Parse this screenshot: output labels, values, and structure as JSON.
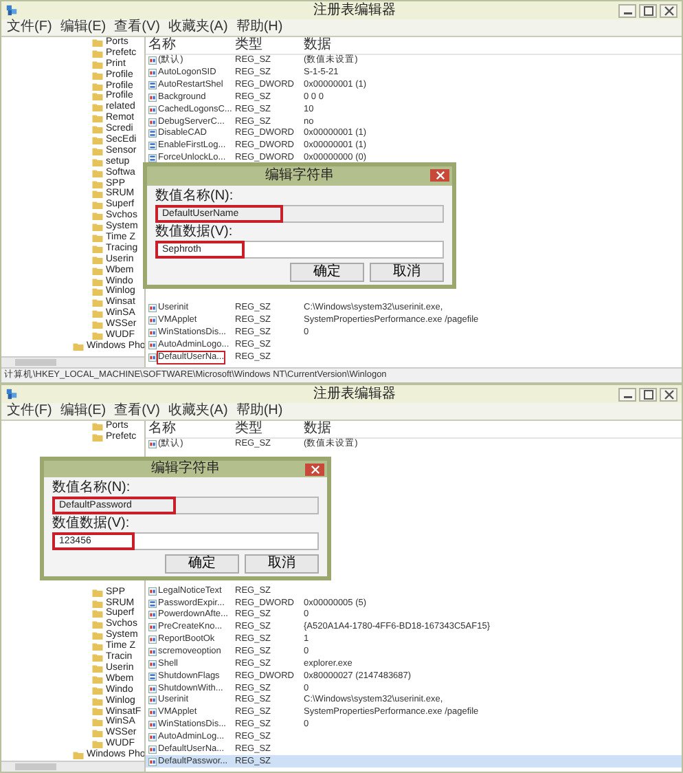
{
  "windows": [
    {
      "title": "注册表编辑器",
      "menu": [
        "文件(F)",
        "编辑(E)",
        "查看(V)",
        "收藏夹(A)",
        "帮助(H)"
      ],
      "tree": {
        "top": [
          {
            "label": "Ports"
          },
          {
            "label": "Prefetc"
          },
          {
            "label": "Print"
          },
          {
            "label": "Profile"
          },
          {
            "label": "Profile"
          },
          {
            "label": "Profile"
          },
          {
            "label": "related"
          },
          {
            "label": "Remot"
          },
          {
            "label": "Scredi"
          },
          {
            "label": "SecEdi"
          },
          {
            "label": "Sensor"
          },
          {
            "label": "setup"
          },
          {
            "label": "Softwa"
          },
          {
            "label": "SPP"
          },
          {
            "label": "SRUM"
          },
          {
            "label": "Superf"
          },
          {
            "label": "Svchos"
          },
          {
            "label": "System"
          },
          {
            "label": "Time Z"
          },
          {
            "label": "Tracing"
          },
          {
            "label": "Userin"
          },
          {
            "label": "Wbem"
          },
          {
            "label": "Windo"
          },
          {
            "label": "Winlog"
          },
          {
            "label": "Winsat"
          },
          {
            "label": "WinSA"
          },
          {
            "label": "WSSer"
          },
          {
            "label": "WUDF"
          },
          {
            "label": "Windows Pho",
            "kind": "outer"
          }
        ]
      },
      "columns": [
        "名称",
        "类型",
        "数据"
      ],
      "rows": {
        "top": [
          {
            "name": "(默认)",
            "type": "REG_SZ",
            "data": "(数值未设置)",
            "kind": "string",
            "highlighted": false,
            "selected": false
          },
          {
            "name": "AutoLogonSID",
            "type": "REG_SZ",
            "data": "S-1-5-21",
            "kind": "string",
            "highlighted": false,
            "selected": false
          },
          {
            "name": "AutoRestartShel",
            "type": "REG_DWORD",
            "data": "0x00000001 (1)",
            "kind": "dword",
            "highlighted": false,
            "selected": false
          },
          {
            "name": "Background",
            "type": "REG_SZ",
            "data": "0 0 0",
            "kind": "string",
            "highlighted": false,
            "selected": false
          },
          {
            "name": "CachedLogonsC...",
            "type": "REG_SZ",
            "data": "10",
            "kind": "string",
            "highlighted": false,
            "selected": false
          },
          {
            "name": "DebugServerC...",
            "type": "REG_SZ",
            "data": "no",
            "kind": "string",
            "highlighted": false,
            "selected": false
          },
          {
            "name": "DisableCAD",
            "type": "REG_DWORD",
            "data": "0x00000001 (1)",
            "kind": "dword",
            "highlighted": false,
            "selected": false
          },
          {
            "name": "EnableFirstLog...",
            "type": "REG_DWORD",
            "data": "0x00000001 (1)",
            "kind": "dword",
            "highlighted": false,
            "selected": false
          },
          {
            "name": "ForceUnlockLo...",
            "type": "REG_DWORD",
            "data": "0x00000000 (0)",
            "kind": "dword",
            "highlighted": false,
            "selected": false
          }
        ],
        "bottom": [
          {
            "name": "Userinit",
            "type": "REG_SZ",
            "data": "C:\\Windows\\system32\\userinit.exe,",
            "kind": "string",
            "highlighted": false,
            "selected": false
          },
          {
            "name": "VMApplet",
            "type": "REG_SZ",
            "data": "SystemPropertiesPerformance.exe /pagefile",
            "kind": "string",
            "highlighted": false,
            "selected": false
          },
          {
            "name": "WinStationsDis...",
            "type": "REG_SZ",
            "data": "0",
            "kind": "string",
            "highlighted": false,
            "selected": false
          },
          {
            "name": "AutoAdminLogo...",
            "type": "REG_SZ",
            "kind": "string",
            "highlighted": false,
            "selected": false
          },
          {
            "name": "DefaultUserNa...",
            "type": "REG_SZ",
            "kind": "string",
            "highlighted": true,
            "selected": false
          }
        ]
      },
      "dialog": {
        "title": "编辑字符串",
        "name_label": "数值名称(N):",
        "name_value": "DefaultUserName",
        "name_highlighted": true,
        "data_label": "数值数据(V):",
        "data_value": "Sephroth",
        "data_highlighted": true,
        "buttons": [
          "确定",
          "取消"
        ]
      },
      "status_bar": "计算机\\HKEY_LOCAL_MACHINE\\SOFTWARE\\Microsoft\\Windows NT\\CurrentVersion\\Winlogon"
    },
    {
      "title": "注册表编辑器",
      "menu": [
        "文件(F)",
        "编辑(E)",
        "查看(V)",
        "收藏夹(A)",
        "帮助(H)"
      ],
      "tree": {
        "top": [
          {
            "label": "Ports"
          },
          {
            "label": "Prefetc"
          }
        ],
        "bottom": [
          {
            "label": "SPP"
          },
          {
            "label": "SRUM"
          },
          {
            "label": "Superf"
          },
          {
            "label": "Svchos"
          },
          {
            "label": "System"
          },
          {
            "label": "Time Z"
          },
          {
            "label": "Tracin"
          },
          {
            "label": "Userin"
          },
          {
            "label": "Wbem"
          },
          {
            "label": "Windo"
          },
          {
            "label": "Winlog"
          },
          {
            "label": "WinsatF"
          },
          {
            "label": "WinSA"
          },
          {
            "label": "WSSer"
          },
          {
            "label": "WUDF"
          },
          {
            "label": "Windows Pho",
            "kind": "outer"
          }
        ]
      },
      "columns": [
        "名称",
        "类型",
        "数据"
      ],
      "rows": {
        "top": [
          {
            "name": "(默认)",
            "type": "REG_SZ",
            "data": "(数值未设置)",
            "kind": "string",
            "highlighted": false,
            "selected": false
          }
        ],
        "bottom": [
          {
            "name": "LegalNoticeText",
            "type": "REG_SZ",
            "kind": "string",
            "highlighted": false,
            "selected": false
          },
          {
            "name": "PasswordExpir...",
            "type": "REG_DWORD",
            "data": "0x00000005 (5)",
            "kind": "dword",
            "highlighted": false,
            "selected": false
          },
          {
            "name": "PowerdownAfte...",
            "type": "REG_SZ",
            "data": "0",
            "kind": "string",
            "highlighted": false,
            "selected": false
          },
          {
            "name": "PreCreateKno...",
            "type": "REG_SZ",
            "data": "{A520A1A4-1780-4FF6-BD18-167343C5AF15}",
            "kind": "string",
            "highlighted": false,
            "selected": false
          },
          {
            "name": "ReportBootOk",
            "type": "REG_SZ",
            "data": "1",
            "kind": "string",
            "highlighted": false,
            "selected": false
          },
          {
            "name": "scremoveoption",
            "type": "REG_SZ",
            "data": "0",
            "kind": "string",
            "highlighted": false,
            "selected": false
          },
          {
            "name": "Shell",
            "type": "REG_SZ",
            "data": "explorer.exe",
            "kind": "string",
            "highlighted": false,
            "selected": false
          },
          {
            "name": "ShutdownFlags",
            "type": "REG_DWORD",
            "data": "0x80000027 (2147483687)",
            "kind": "dword",
            "highlighted": false,
            "selected": false
          },
          {
            "name": "ShutdownWith...",
            "type": "REG_SZ",
            "data": "0",
            "kind": "string",
            "highlighted": false,
            "selected": false
          },
          {
            "name": "Userinit",
            "type": "REG_SZ",
            "data": "C:\\Windows\\system32\\userinit.exe,",
            "kind": "string",
            "highlighted": false,
            "selected": false
          },
          {
            "name": "VMApplet",
            "type": "REG_SZ",
            "data": "SystemPropertiesPerformance.exe /pagefile",
            "kind": "string",
            "highlighted": false,
            "selected": false
          },
          {
            "name": "WinStationsDis...",
            "type": "REG_SZ",
            "data": "0",
            "kind": "string",
            "highlighted": false,
            "selected": false
          },
          {
            "name": "AutoAdminLog...",
            "type": "REG_SZ",
            "kind": "string",
            "highlighted": false,
            "selected": false
          },
          {
            "name": "DefaultUserNa...",
            "type": "REG_SZ",
            "kind": "string",
            "highlighted": false,
            "selected": false
          },
          {
            "name": "DefaultPasswor...",
            "type": "REG_SZ",
            "kind": "string",
            "highlighted": false,
            "selected": true
          }
        ]
      },
      "dialog": {
        "title": "编辑字符串",
        "name_label": "数值名称(N):",
        "name_value": "DefaultPassword",
        "name_highlighted": true,
        "data_label": "数值数据(V):",
        "data_value": "123456",
        "data_highlighted": true,
        "buttons": [
          "确定",
          "取消"
        ]
      }
    }
  ]
}
